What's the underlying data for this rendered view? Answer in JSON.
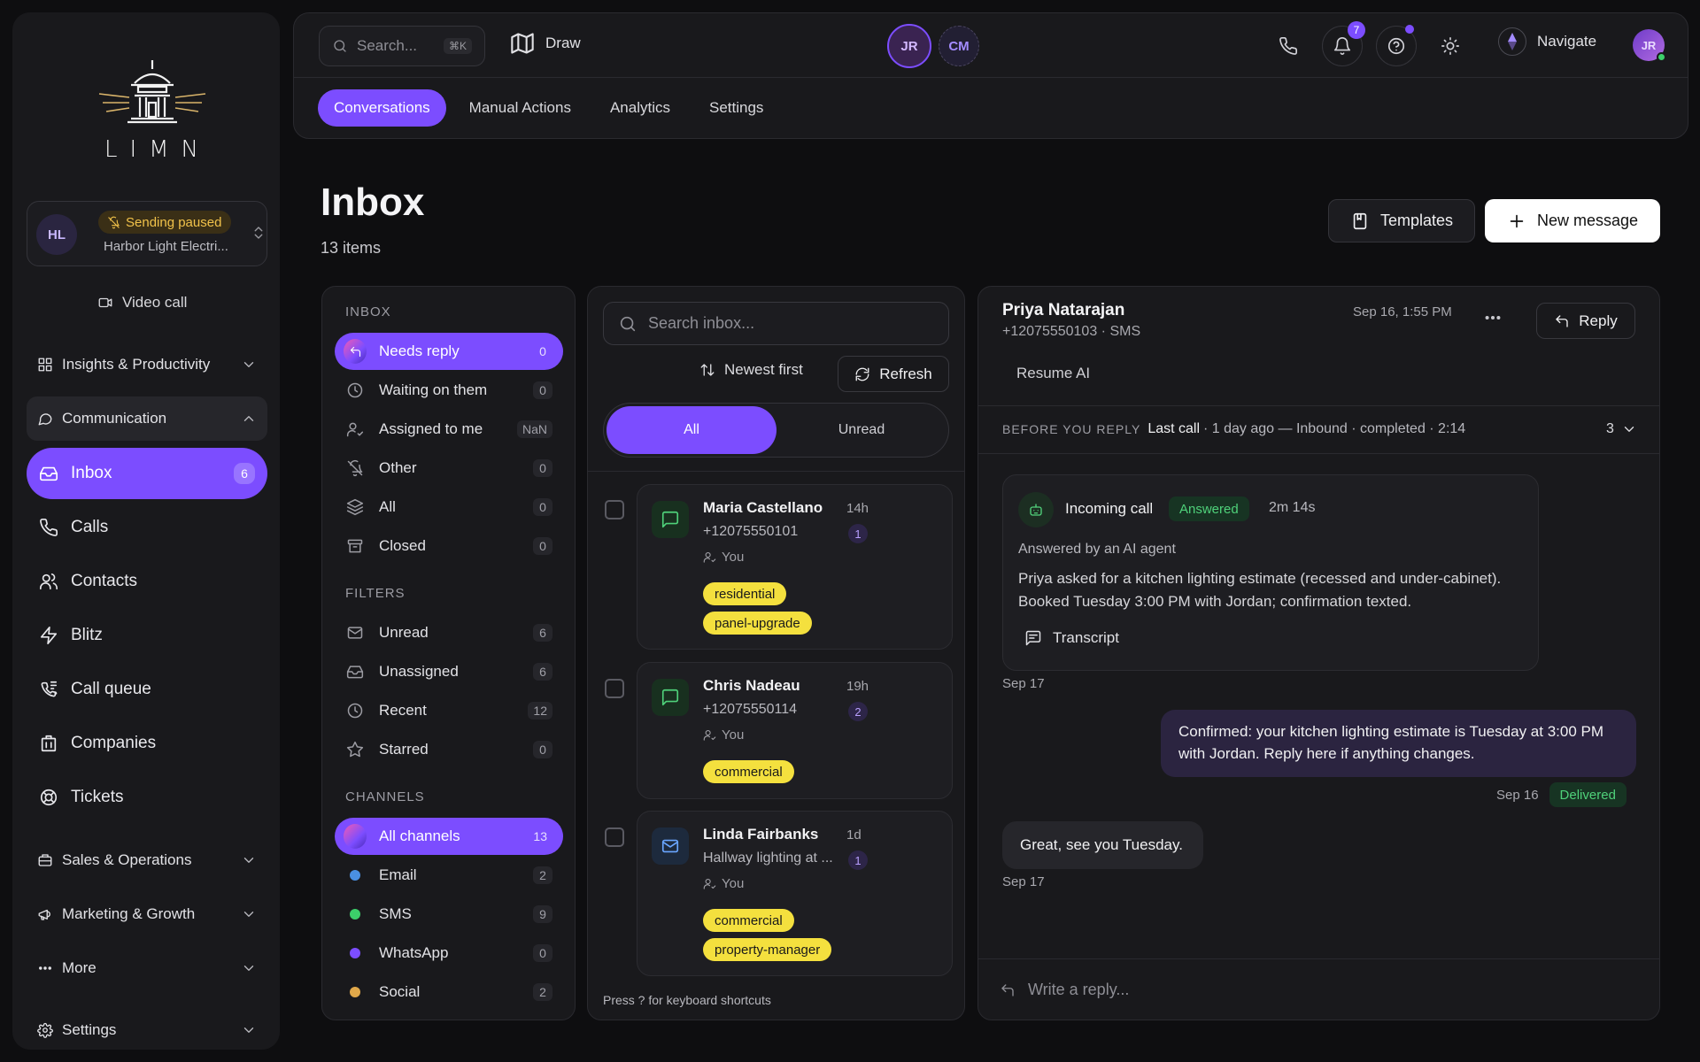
{
  "brand": {
    "name": "LIMN"
  },
  "workspace": {
    "initials": "HL",
    "status": "Sending paused",
    "name": "Harbor Light Electri..."
  },
  "sidebar": {
    "video_call": "Video call",
    "sections": [
      {
        "label": "Insights & Productivity"
      },
      {
        "label": "Communication"
      },
      {
        "label": "Sales & Operations"
      },
      {
        "label": "Marketing & Growth"
      },
      {
        "label": "More"
      },
      {
        "label": "Settings"
      }
    ],
    "items": [
      {
        "label": "Inbox",
        "count": "6",
        "icon": "inbox-icon"
      },
      {
        "label": "Calls",
        "icon": "phone-icon"
      },
      {
        "label": "Contacts",
        "icon": "users-icon"
      },
      {
        "label": "Blitz",
        "icon": "bolt-icon"
      },
      {
        "label": "Call queue",
        "icon": "phone-queue-icon"
      },
      {
        "label": "Companies",
        "icon": "building-icon"
      },
      {
        "label": "Tickets",
        "icon": "lifebuoy-icon"
      }
    ]
  },
  "topbar": {
    "search_placeholder": "Search...",
    "search_shortcut": "⌘K",
    "draw_label": "Draw",
    "presence": [
      "JR",
      "CM"
    ],
    "notification_count": "7",
    "navigate_label": "Navigate",
    "user_initials": "JR"
  },
  "tabs": [
    {
      "label": "Conversations"
    },
    {
      "label": "Manual Actions"
    },
    {
      "label": "Analytics"
    },
    {
      "label": "Settings"
    }
  ],
  "header": {
    "title": "Inbox",
    "count_text": "13 items",
    "templates_label": "Templates",
    "new_message_label": "New message"
  },
  "folders": {
    "inbox_title": "INBOX",
    "inbox_items": [
      {
        "label": "Needs reply",
        "count": "0"
      },
      {
        "label": "Waiting on them",
        "count": "0"
      },
      {
        "label": "Assigned to me",
        "count": "NaN"
      },
      {
        "label": "Other",
        "count": "0"
      },
      {
        "label": "All",
        "count": "0"
      },
      {
        "label": "Closed",
        "count": "0"
      }
    ],
    "filters_title": "FILTERS",
    "filter_items": [
      {
        "label": "Unread",
        "count": "6"
      },
      {
        "label": "Unassigned",
        "count": "6"
      },
      {
        "label": "Recent",
        "count": "12"
      },
      {
        "label": "Starred",
        "count": "0"
      }
    ],
    "channels_title": "CHANNELS",
    "channel_items": [
      {
        "label": "All channels",
        "count": "13"
      },
      {
        "label": "Email",
        "count": "2",
        "color": "#4a90e2"
      },
      {
        "label": "SMS",
        "count": "9",
        "color": "#3ccf6a"
      },
      {
        "label": "WhatsApp",
        "count": "0",
        "color": "#7c4dff"
      },
      {
        "label": "Social",
        "count": "2",
        "color": "#e0a84a"
      }
    ]
  },
  "list": {
    "search_placeholder": "Search inbox...",
    "sort_label": "Newest first",
    "refresh_label": "Refresh",
    "seg_all": "All",
    "seg_unread": "Unread",
    "footer_hint": "Press ? for keyboard shortcuts",
    "conversations": [
      {
        "name": "Maria Castellano",
        "sub": "+12075550101",
        "time": "14h",
        "badge": "1",
        "owner": "You",
        "channel": "sms",
        "tags": [
          "residential",
          "panel-upgrade"
        ]
      },
      {
        "name": "Chris Nadeau",
        "sub": "+12075550114",
        "time": "19h",
        "badge": "2",
        "owner": "You",
        "channel": "sms",
        "tags": [
          "commercial"
        ]
      },
      {
        "name": "Linda Fairbanks",
        "sub": "Hallway lighting at ...",
        "time": "1d",
        "badge": "1",
        "owner": "You",
        "channel": "email",
        "tags": [
          "commercial",
          "property-manager"
        ]
      }
    ]
  },
  "detail": {
    "contact_name": "Priya Natarajan",
    "contact_sub": "+12075550103 · SMS",
    "date": "Sep 16, 1:55 PM",
    "reply_label": "Reply",
    "resume_ai": "Resume AI",
    "before_you_reply_label": "BEFORE YOU REPLY",
    "last_call_label": "Last call",
    "last_call_text": "· 1 day ago — Inbound · completed · 2:14",
    "context_count": "3",
    "call_card": {
      "title": "Incoming call",
      "status": "Answered",
      "duration": "2m 14s",
      "answered_by": "Answered by an AI agent",
      "summary": "Priya asked for a kitchen lighting estimate (recessed and under-cabinet). Booked Tuesday 3:00 PM with Jordan; confirmation texted.",
      "transcript_label": "Transcript",
      "date": "Sep 17"
    },
    "outgoing": {
      "text": "Confirmed: your kitchen lighting estimate is Tuesday at 3:00 PM with Jordan. Reply here if anything changes.",
      "date": "Sep 16",
      "status": "Delivered"
    },
    "incoming": {
      "text": "Great, see you Tuesday.",
      "date": "Sep 17"
    },
    "compose_placeholder": "Write a reply..."
  },
  "colors": {
    "accent": "#7c4dff",
    "tag": "#f4e03e",
    "success": "#4fd17a",
    "warning": "#f1c24a"
  }
}
